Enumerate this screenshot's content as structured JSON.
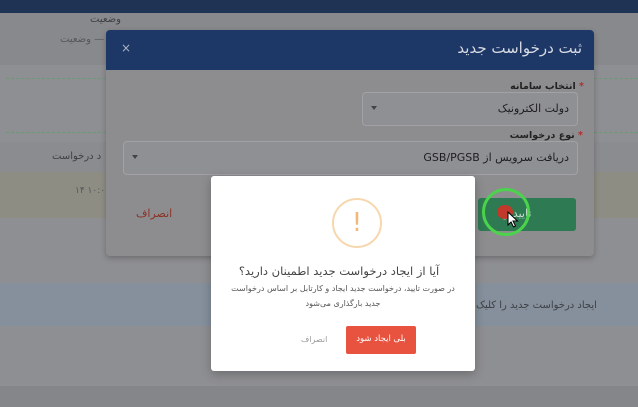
{
  "background": {
    "status_label": "وضعیت",
    "status_placeholder": "— وضعیت",
    "request_column": "د درخواست",
    "time": "۱۰:۰۰ ۱۴",
    "hint": "ایجاد درخواست جدید را کلیک"
  },
  "modal": {
    "title": "ثبت درخواست جدید",
    "close": "×",
    "system_label": "انتخاب سامانه",
    "system_value": "دولت الکترونیک",
    "type_label": "نوع درخواست",
    "type_value": "دریافت سرویس از GSB/PGSB",
    "required_mark": "*",
    "confirm_label": "تایید و",
    "cancel_label": "انصراف"
  },
  "alert": {
    "icon": "!",
    "title": "آیا از ایجاد درخواست جدید اطمینان دارید؟",
    "text": "در صورت تایید، درخواست جدید ایجاد و کارتابل بر اساس درخواست جدید بارگذاری می‌شود",
    "ok_label": "بلی ایجاد شود",
    "cancel_label": "انصراف"
  },
  "colors": {
    "header": "#1d3766",
    "confirm": "#2e7a52",
    "alert_ok": "#e8533f",
    "warning_icon": "#f2b87a",
    "click_ring": "#4bd34b"
  }
}
